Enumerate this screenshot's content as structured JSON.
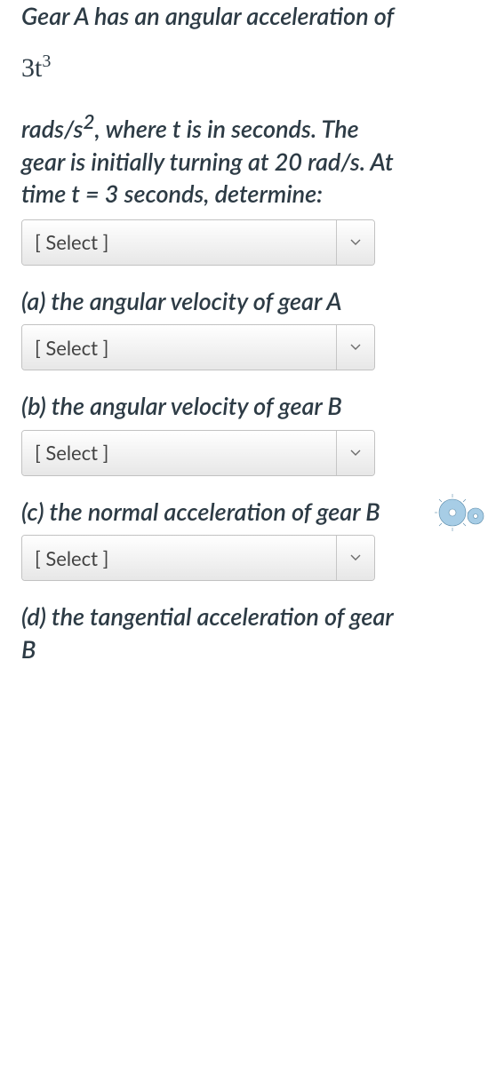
{
  "problem": {
    "line1": "Gear A has an angular acceleration of",
    "formula_base": "3t",
    "formula_exp": "3",
    "line2_pre": "rads/s",
    "line2_exp": "2",
    "line2_post": ", where t is in seconds. The gear is initially turning at 20 rad/s. At time t = 3 seconds, determine:"
  },
  "selects": {
    "s0": {
      "placeholder": "[ Select ]"
    },
    "s1": {
      "placeholder": "[ Select ]"
    },
    "s2": {
      "placeholder": "[ Select ]"
    },
    "s3": {
      "placeholder": "[ Select ]"
    }
  },
  "parts": {
    "a": "(a) the angular velocity of gear A",
    "b": "(b) the angular velocity of gear B",
    "c": "(c) the normal acceleration of gear B",
    "d": "(d) the tangential acceleration of gear B"
  }
}
